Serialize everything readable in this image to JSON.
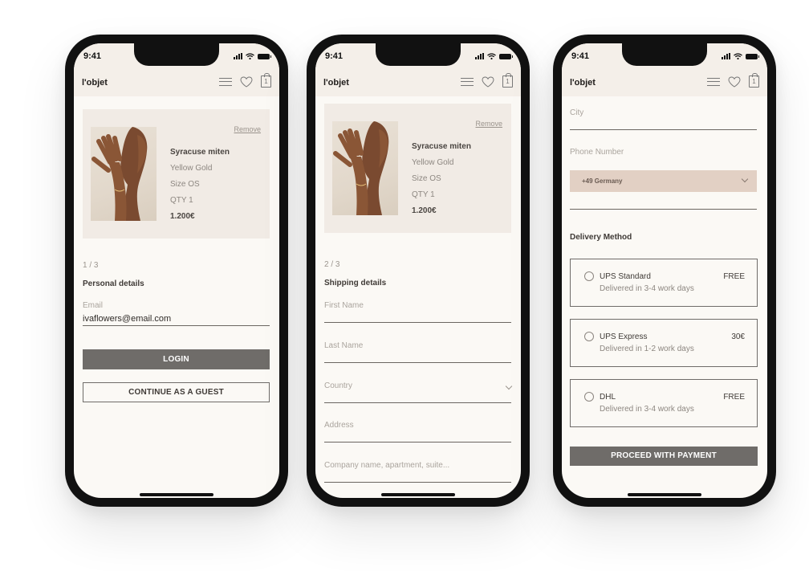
{
  "status_time": "9:41",
  "brand": "l'objet",
  "bag_count": "1",
  "product": {
    "remove_label": "Remove",
    "name": "Syracuse miten",
    "material": "Yellow Gold",
    "size": "Size OS",
    "qty": "QTY 1",
    "price": "1.200€"
  },
  "screen1": {
    "step": "1 / 3",
    "section_title": "Personal details",
    "email_label": "Email",
    "email_value": "ivaflowers@email.com",
    "login_label": "LOGIN",
    "guest_label": "CONTINUE AS A GUEST"
  },
  "screen2": {
    "step": "2 / 3",
    "section_title": "Shipping details",
    "first_name_label": "First Name",
    "last_name_label": "Last Name",
    "country_label": "Country",
    "address_label": "Address",
    "company_label": "Company name, apartment, suite..."
  },
  "screen3": {
    "city_label": "City",
    "phone_label": "Phone Number",
    "phone_country": "+49 Germany",
    "delivery_title": "Delivery Method",
    "options": [
      {
        "name": "UPS Standard",
        "desc": "Delivered in 3-4 work days",
        "price": "FREE"
      },
      {
        "name": "UPS Express",
        "desc": "Delivered in 1-2 work days",
        "price": "30€"
      },
      {
        "name": "DHL",
        "desc": "Delivered in 3-4 work days",
        "price": "FREE"
      }
    ],
    "proceed_label": "PROCEED WITH PAYMENT"
  },
  "colors": {
    "screen_bg": "#fbf9f5",
    "header_bg": "#f4efe9",
    "card_bg": "#f1ebe5",
    "button_dark": "#6f6c69",
    "select_bg": "#e2d0c4"
  }
}
